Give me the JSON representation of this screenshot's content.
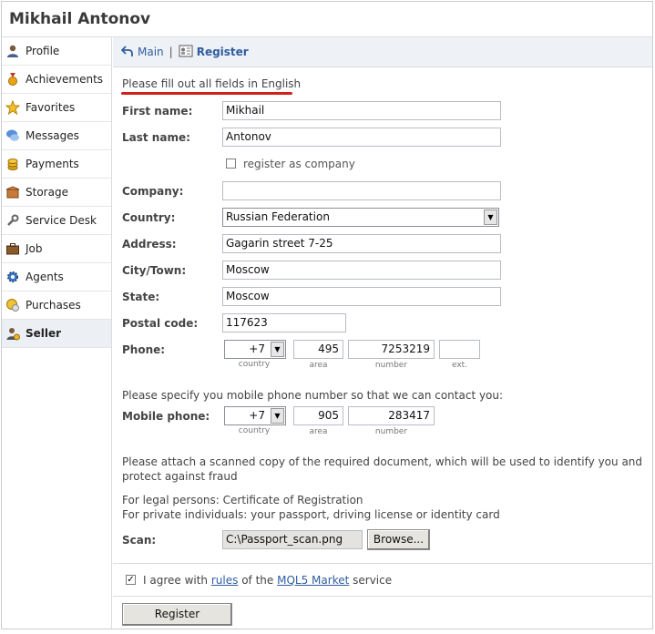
{
  "header": {
    "user_name": "Mikhail Antonov"
  },
  "sidebar": {
    "items": [
      {
        "label": "Profile",
        "icon": "user-icon"
      },
      {
        "label": "Achievements",
        "icon": "medal-icon"
      },
      {
        "label": "Favorites",
        "icon": "star-icon"
      },
      {
        "label": "Messages",
        "icon": "chat-icon"
      },
      {
        "label": "Payments",
        "icon": "coins-icon"
      },
      {
        "label": "Storage",
        "icon": "box-icon"
      },
      {
        "label": "Service Desk",
        "icon": "wrench-icon"
      },
      {
        "label": "Job",
        "icon": "briefcase-icon"
      },
      {
        "label": "Agents",
        "icon": "gear-icon"
      },
      {
        "label": "Purchases",
        "icon": "coin-purchase-icon"
      },
      {
        "label": "Seller",
        "icon": "seller-icon",
        "active": true
      }
    ]
  },
  "nav": {
    "main_label": "Main",
    "separator": "|",
    "current_label": "Register"
  },
  "form": {
    "notice": "Please fill out all fields in English",
    "first_name": {
      "label": "First name:",
      "value": "Mikhail"
    },
    "last_name": {
      "label": "Last name:",
      "value": "Antonov"
    },
    "register_as_company": {
      "label": "register as company",
      "checked": false
    },
    "company": {
      "label": "Company:",
      "value": ""
    },
    "country": {
      "label": "Country:",
      "value": "Russian Federation"
    },
    "address": {
      "label": "Address:",
      "value": "Gagarin street 7-25"
    },
    "city": {
      "label": "City/Town:",
      "value": "Moscow"
    },
    "state": {
      "label": "State:",
      "value": "Moscow"
    },
    "postal_code": {
      "label": "Postal code:",
      "value": "117623"
    },
    "phone": {
      "label": "Phone:",
      "country": "+7",
      "area": "495",
      "number": "7253219",
      "ext": "",
      "country_caption": "country",
      "area_caption": "area",
      "number_caption": "number",
      "ext_caption": "ext."
    },
    "mobile_prompt": "Please specify you mobile phone number so that we can contact you:",
    "mobile": {
      "label": "Mobile phone:",
      "country": "+7",
      "area": "905",
      "number": "283417",
      "country_caption": "country",
      "area_caption": "area",
      "number_caption": "number"
    },
    "attach_text_1": "Please attach a scanned copy of the required document, which will be used to identify you and",
    "attach_text_2": "protect against fraud",
    "legal_text": "For legal persons: Certificate of Registration",
    "private_text": "For private individuals: your passport, driving license or identity card",
    "scan": {
      "label": "Scan:",
      "value": "C:\\Passport_scan.png",
      "browse_label": "Browse..."
    },
    "agree": {
      "checked": true,
      "prefix": "I agree with",
      "rules_link": "rules",
      "middle": "of the",
      "market_link": "MQL5 Market",
      "suffix": "service"
    },
    "submit_label": "Register"
  },
  "colors": {
    "link": "#2f5d9e",
    "notice_underline": "#d0201c",
    "active_bg": "#eceff3"
  }
}
